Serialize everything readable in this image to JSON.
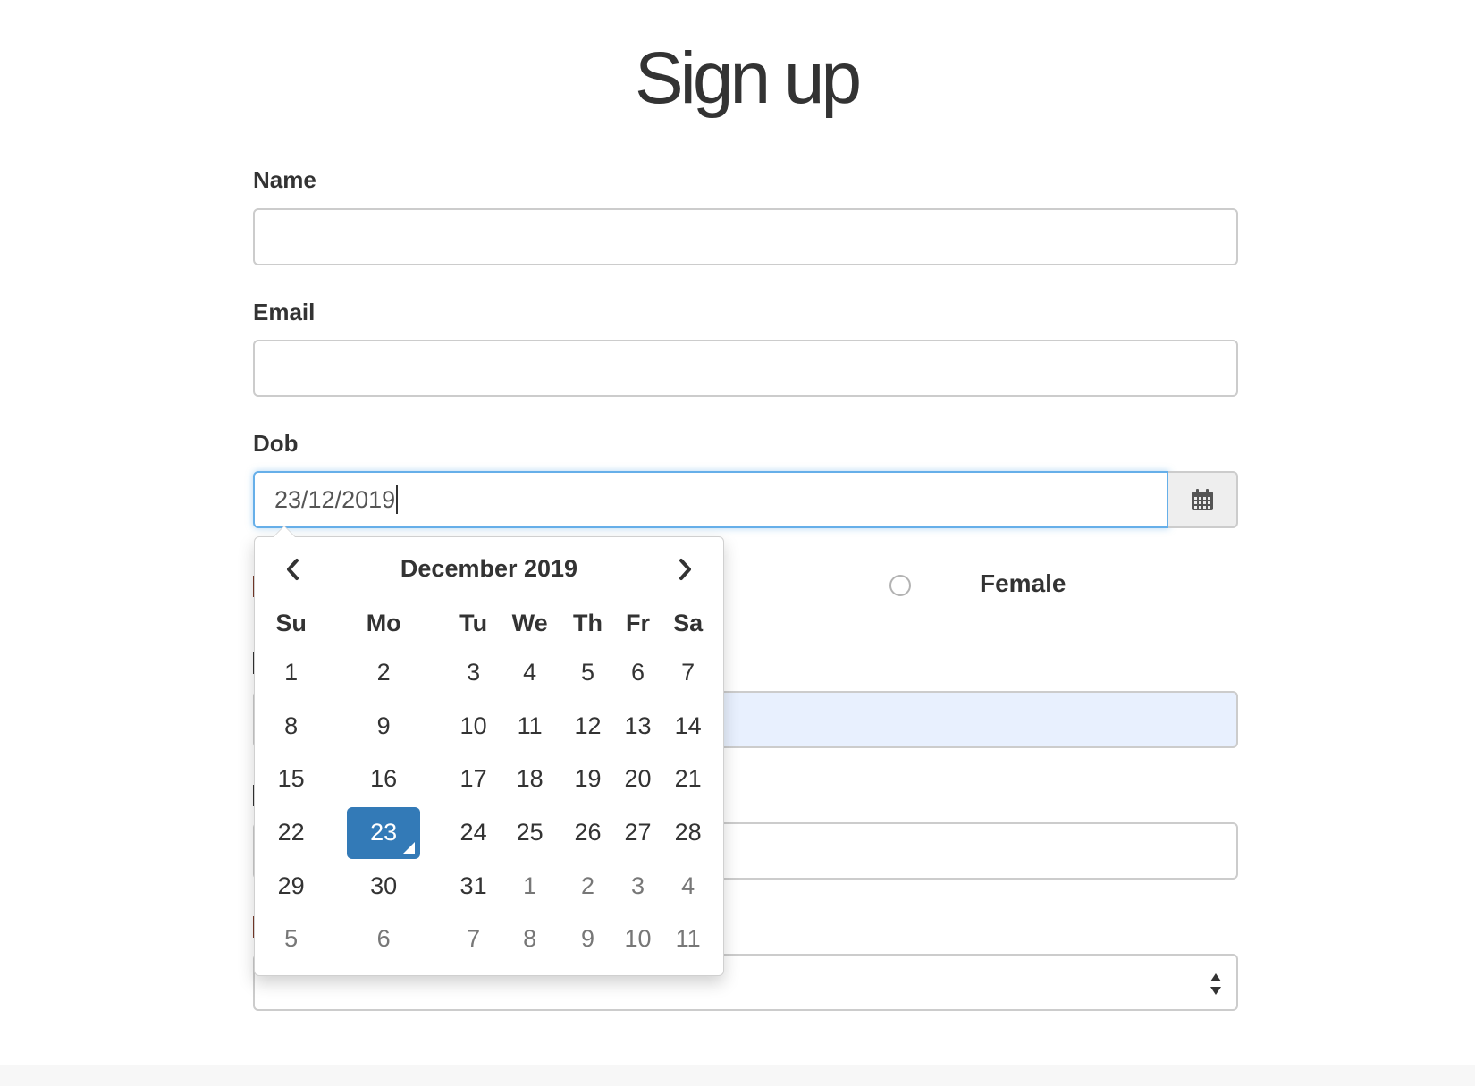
{
  "page": {
    "title": "Sign up"
  },
  "form": {
    "name_label": "Name",
    "name_value": "",
    "email_label": "Email",
    "email_value": "",
    "dob_label": "Dob",
    "dob_value": "23/12/2019",
    "calendar_icon": "calendar-icon",
    "gender_options": [
      "Female"
    ],
    "select_value": ""
  },
  "datepicker": {
    "month_title": "December 2019",
    "prev_icon": "chevron-left-icon",
    "next_icon": "chevron-right-icon",
    "weekdays": [
      "Su",
      "Mo",
      "Tu",
      "We",
      "Th",
      "Fr",
      "Sa"
    ],
    "weeks": [
      [
        "1",
        "2",
        "3",
        "4",
        "5",
        "6",
        "7"
      ],
      [
        "8",
        "9",
        "10",
        "11",
        "12",
        "13",
        "14"
      ],
      [
        "15",
        "16",
        "17",
        "18",
        "19",
        "20",
        "21"
      ],
      [
        "22",
        "23",
        "24",
        "25",
        "26",
        "27",
        "28"
      ],
      [
        "29",
        "30",
        "31",
        "1",
        "2",
        "3",
        "4"
      ],
      [
        "5",
        "6",
        "7",
        "8",
        "9",
        "10",
        "11"
      ]
    ],
    "selected_day": "23",
    "accent_color": "#337ab7"
  }
}
